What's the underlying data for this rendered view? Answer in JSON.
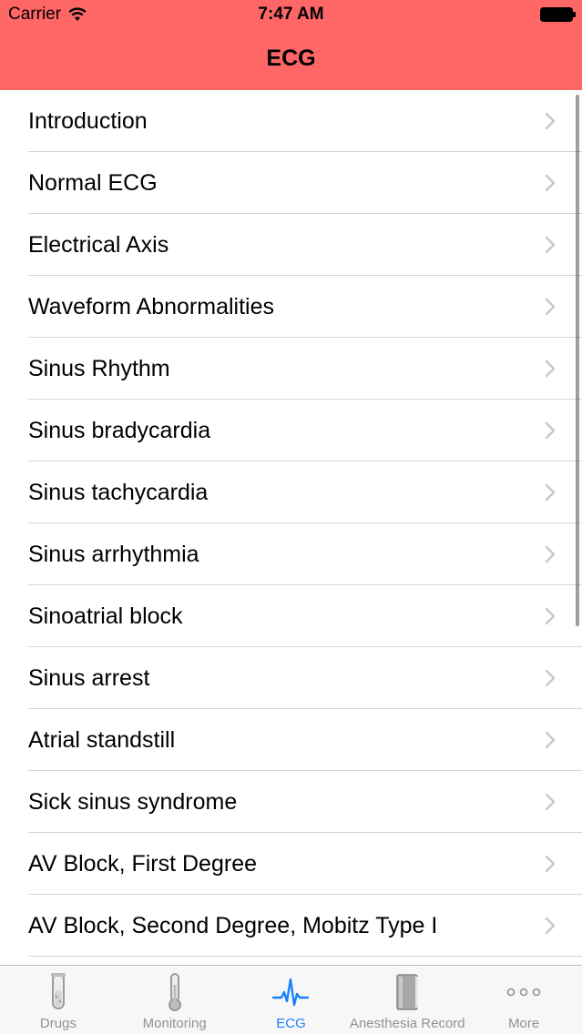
{
  "status_bar": {
    "carrier": "Carrier",
    "time": "7:47 AM"
  },
  "nav": {
    "title": "ECG",
    "background_color": "#ff6666"
  },
  "list": {
    "items": [
      {
        "label": "Introduction"
      },
      {
        "label": "Normal ECG"
      },
      {
        "label": "Electrical Axis"
      },
      {
        "label": "Waveform Abnormalities"
      },
      {
        "label": "Sinus Rhythm"
      },
      {
        "label": "Sinus bradycardia"
      },
      {
        "label": "Sinus tachycardia"
      },
      {
        "label": "Sinus arrhythmia"
      },
      {
        "label": "Sinoatrial block"
      },
      {
        "label": "Sinus arrest"
      },
      {
        "label": "Atrial standstill"
      },
      {
        "label": "Sick sinus syndrome"
      },
      {
        "label": "AV Block, First Degree"
      },
      {
        "label": "AV Block, Second Degree, Mobitz Type I"
      }
    ]
  },
  "tabbar": {
    "active_color": "#1a82fb",
    "inactive_color": "#929292",
    "tabs": [
      {
        "label": "Drugs",
        "icon": "test-tube-icon",
        "active": false
      },
      {
        "label": "Monitoring",
        "icon": "thermometer-icon",
        "active": false
      },
      {
        "label": "ECG",
        "icon": "ecg-waveform-icon",
        "active": true
      },
      {
        "label": "Anesthesia Record",
        "icon": "book-icon",
        "active": false
      },
      {
        "label": "More",
        "icon": "more-dots-icon",
        "active": false
      }
    ]
  }
}
